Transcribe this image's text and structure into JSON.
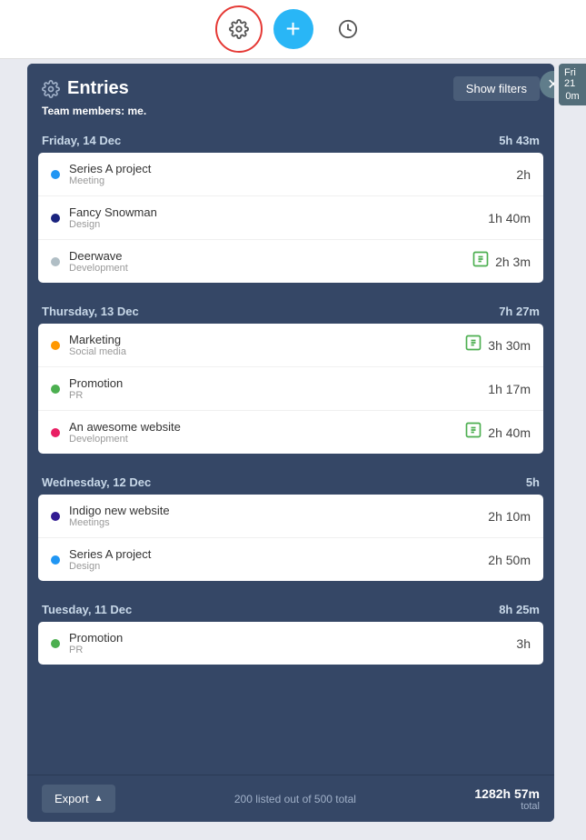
{
  "topbar": {
    "settings_icon": "⊙",
    "add_icon": "+",
    "history_icon": "🕐"
  },
  "sidebar": {
    "label": "Fri 21",
    "sub": "0m"
  },
  "panel": {
    "title": "Entries",
    "subtitle_prefix": "Team members: ",
    "subtitle_user": "me.",
    "show_filters_label": "Show filters",
    "close_icon": "✕",
    "days": [
      {
        "date": "Friday, 14 Dec",
        "total": "5h 43m",
        "entries": [
          {
            "dot": "#2196f3",
            "name": "Series A project",
            "sub": "Meeting",
            "time": "2h",
            "has_timer": false
          },
          {
            "dot": "#1a237e",
            "name": "Fancy Snowman",
            "sub": "Design",
            "time": "1h 40m",
            "has_timer": false
          },
          {
            "dot": "#b0bec5",
            "name": "Deerwave",
            "sub": "Development",
            "time": "2h 3m",
            "has_timer": true
          }
        ]
      },
      {
        "date": "Thursday, 13 Dec",
        "total": "7h 27m",
        "entries": [
          {
            "dot": "#ff9800",
            "name": "Marketing",
            "sub": "Social media",
            "time": "3h 30m",
            "has_timer": true
          },
          {
            "dot": "#4caf50",
            "name": "Promotion",
            "sub": "PR",
            "time": "1h 17m",
            "has_timer": false
          },
          {
            "dot": "#e91e63",
            "name": "An awesome website",
            "sub": "Development",
            "time": "2h 40m",
            "has_timer": true
          }
        ]
      },
      {
        "date": "Wednesday, 12 Dec",
        "total": "5h",
        "entries": [
          {
            "dot": "#311b92",
            "name": "Indigo new website",
            "sub": "Meetings",
            "time": "2h 10m",
            "has_timer": false
          },
          {
            "dot": "#2196f3",
            "name": "Series A project",
            "sub": "Design",
            "time": "2h 50m",
            "has_timer": false
          }
        ]
      },
      {
        "date": "Tuesday, 11 Dec",
        "total": "8h 25m",
        "entries": [
          {
            "dot": "#4caf50",
            "name": "Promotion",
            "sub": "PR",
            "time": "3h",
            "has_timer": false
          }
        ]
      }
    ],
    "footer": {
      "export_label": "Export",
      "count_text": "200 listed out of 500 total",
      "total_time": "1282h 57m",
      "total_label": "total"
    }
  }
}
